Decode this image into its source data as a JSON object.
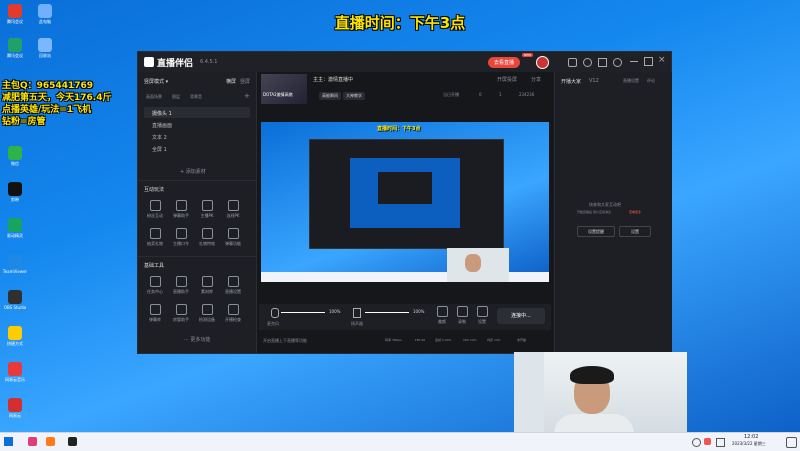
{
  "banner": {
    "title": "直播时间：下午3点"
  },
  "overlay": {
    "line1": "主包Q：965441769",
    "line2": "减肥第五天，今天176.4斤",
    "line3": "点播英雄/玩法=1飞机",
    "line4": "钻粉=房管"
  },
  "desktop_icons": [
    {
      "label": "腾讯会议",
      "color": "#e23b2e"
    },
    {
      "label": "此电脑",
      "color": "#6fb0ff"
    },
    {
      "label": "腾讯会议",
      "color": "#22a06b"
    },
    {
      "label": "回收站",
      "color": "#7bb7ff"
    },
    {
      "label": "微信",
      "color": "#2db34a"
    },
    {
      "label": "剪映",
      "color": "#111111"
    },
    {
      "label": "驱动精灵",
      "color": "#1aa260"
    },
    {
      "label": "TeamViewer",
      "color": "#1e88e5"
    },
    {
      "label": "OBS Studio",
      "color": "#303030"
    },
    {
      "label": "快捷方式",
      "color": "#ffcc00"
    },
    {
      "label": "网易云音乐",
      "color": "#e83a3a"
    },
    {
      "label": "网易云",
      "color": "#d32f2f"
    }
  ],
  "app": {
    "name": "直播伴侣",
    "version": "6.4.5.1",
    "title_btn": "去看直播",
    "title_btn_badge": "NEW",
    "sidebar": {
      "mode_label": "竖屏模式",
      "mode_tab_a": "横屏",
      "mode_tab_b": "竖屏",
      "scene_tabs": [
        "画面场景",
        "图层",
        "背景音"
      ],
      "scenes": [
        "摄像头 1",
        "直播画面",
        "文本 2",
        "全屏 1"
      ],
      "add_material": "+ 添加素材",
      "interact_title": "互动玩法",
      "interact_tools": [
        "粉丝互动",
        "弹幕助手",
        "主播PK",
        "连线PK",
        "抽奖礼物",
        "主播口令",
        "礼物特效",
        "弹幕功能"
      ],
      "basic_title": "基础工具",
      "basic_tools": [
        "任务中心",
        "直播助手",
        "素材库",
        "直播设置",
        "弹幕库",
        "房管助手",
        "检测设备",
        "开播检查"
      ],
      "more_tools": "更多功能"
    },
    "center": {
      "live_label": "主主：激情直播中",
      "game_label": "DOTA2激情高燃",
      "tags": [
        "高能瞬间",
        "大神教学"
      ],
      "share": "分享",
      "open_screen": "开屏投屏",
      "stat1": "当日开播",
      "stat2": "0",
      "stat3": "1",
      "stat4": "234236",
      "mic_label": "麦克风",
      "mic_pct": "100%",
      "spk_label": "扬声器",
      "spk_pct": "100%",
      "tools": [
        "美颜",
        "录制",
        "设置"
      ],
      "start_btn": "连接中...",
      "status_note": "开启直播上下直播等功能",
      "status_items": [
        "码率 3Mbps",
        "FPS 60",
        "丢帧 0.00%",
        "CPU 10%",
        "内存 14%",
        "未开播"
      ],
      "inner_banner": "直播时间：下午3点"
    },
    "right": {
      "tabs": [
        "开播大家",
        "V12"
      ],
      "actions": [
        "直播设置",
        "评论"
      ],
      "empty_title": "快来和大家互动吧",
      "empty_sub": "开始直播后 观众互动消息",
      "empty_link": "查看更多",
      "btn_a": "设置提醒",
      "btn_b": "设置"
    }
  },
  "taskbar": {
    "time": "12:02",
    "date": "2023/3/22 星期三"
  }
}
